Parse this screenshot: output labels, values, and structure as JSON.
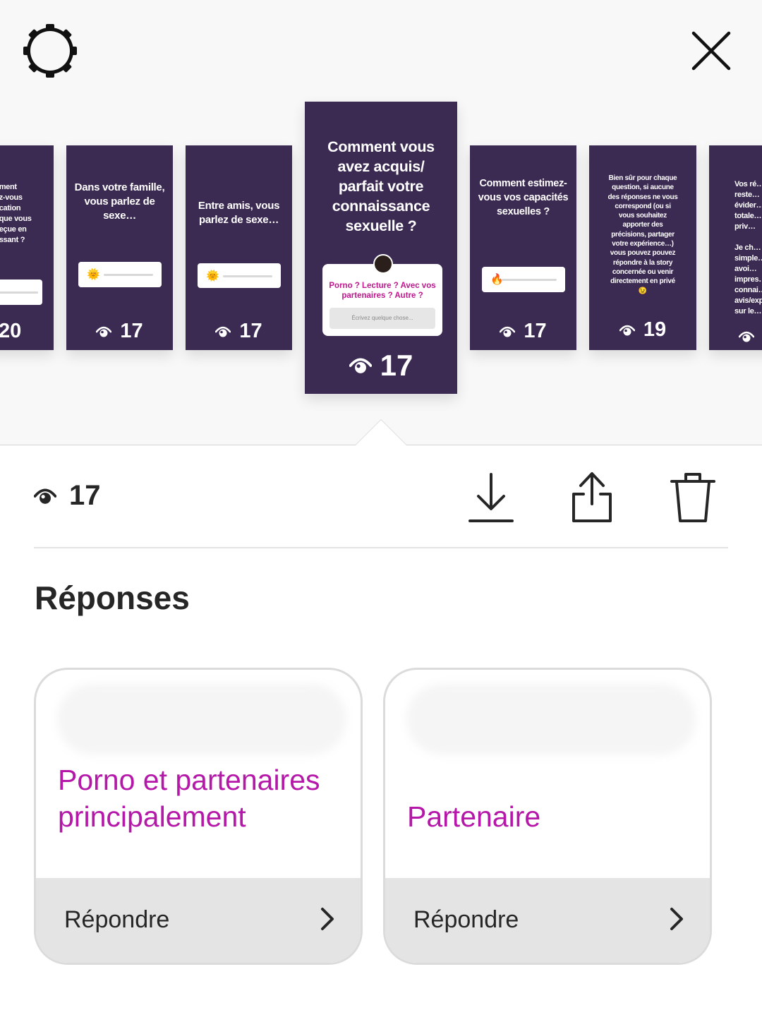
{
  "header": {
    "settings_icon": "gear-icon",
    "close_icon": "close-icon"
  },
  "stories": [
    {
      "question": "…ment\n…z-vous\n…cation\n…que vous\n…eçue en\n…ssant ?",
      "views": "20",
      "type": "slider"
    },
    {
      "question": "Dans votre famille, vous parlez de sexe…",
      "views": "17",
      "type": "slider",
      "emoji": "🌞"
    },
    {
      "question": "Entre amis, vous parlez de sexe…",
      "views": "17",
      "type": "slider",
      "emoji": "🌞"
    },
    {
      "question": "Comment vous avez acquis/ parfait votre connaissance sexuelle ?",
      "views": "17",
      "type": "question",
      "prompt": "Porno ? Lecture ? Avec vos partenaires ? Autre ?",
      "input_placeholder": "Écrivez quelque chose..."
    },
    {
      "question": "Comment estimez-vous vos capacités sexuelles ?",
      "views": "17",
      "type": "slider",
      "emoji": "🔥"
    },
    {
      "question": "Bien sûr pour chaque question, si aucune des réponses ne vous correspond (ou si vous souhaitez apporter des précisions, partager votre expérience…) vous pouvez pouvez répondre à la story concernée ou venir directement en privé 😉",
      "views": "19",
      "type": "text"
    },
    {
      "question": "Vos ré…\nreste…\névider…\ntotale…\npriv…\n\nJe ch…\nsimple…\navoi…\nimpres…\nconnai…\navis/exp…\nsur le…",
      "views": "",
      "type": "text"
    }
  ],
  "stats": {
    "views": "17",
    "download_icon": "download-icon",
    "share_icon": "share-icon",
    "delete_icon": "trash-icon"
  },
  "responses": {
    "title": "Réponses",
    "items": [
      {
        "answer": "Porno et partenaires principalement",
        "reply_label": "Répondre"
      },
      {
        "answer": "Partenaire",
        "reply_label": "Répondre"
      }
    ]
  },
  "colors": {
    "story_bg": "#3b2a52",
    "answer_text": "#b517a8",
    "prompt_text": "#c0178f",
    "reply_bg": "#e4e4e4"
  }
}
